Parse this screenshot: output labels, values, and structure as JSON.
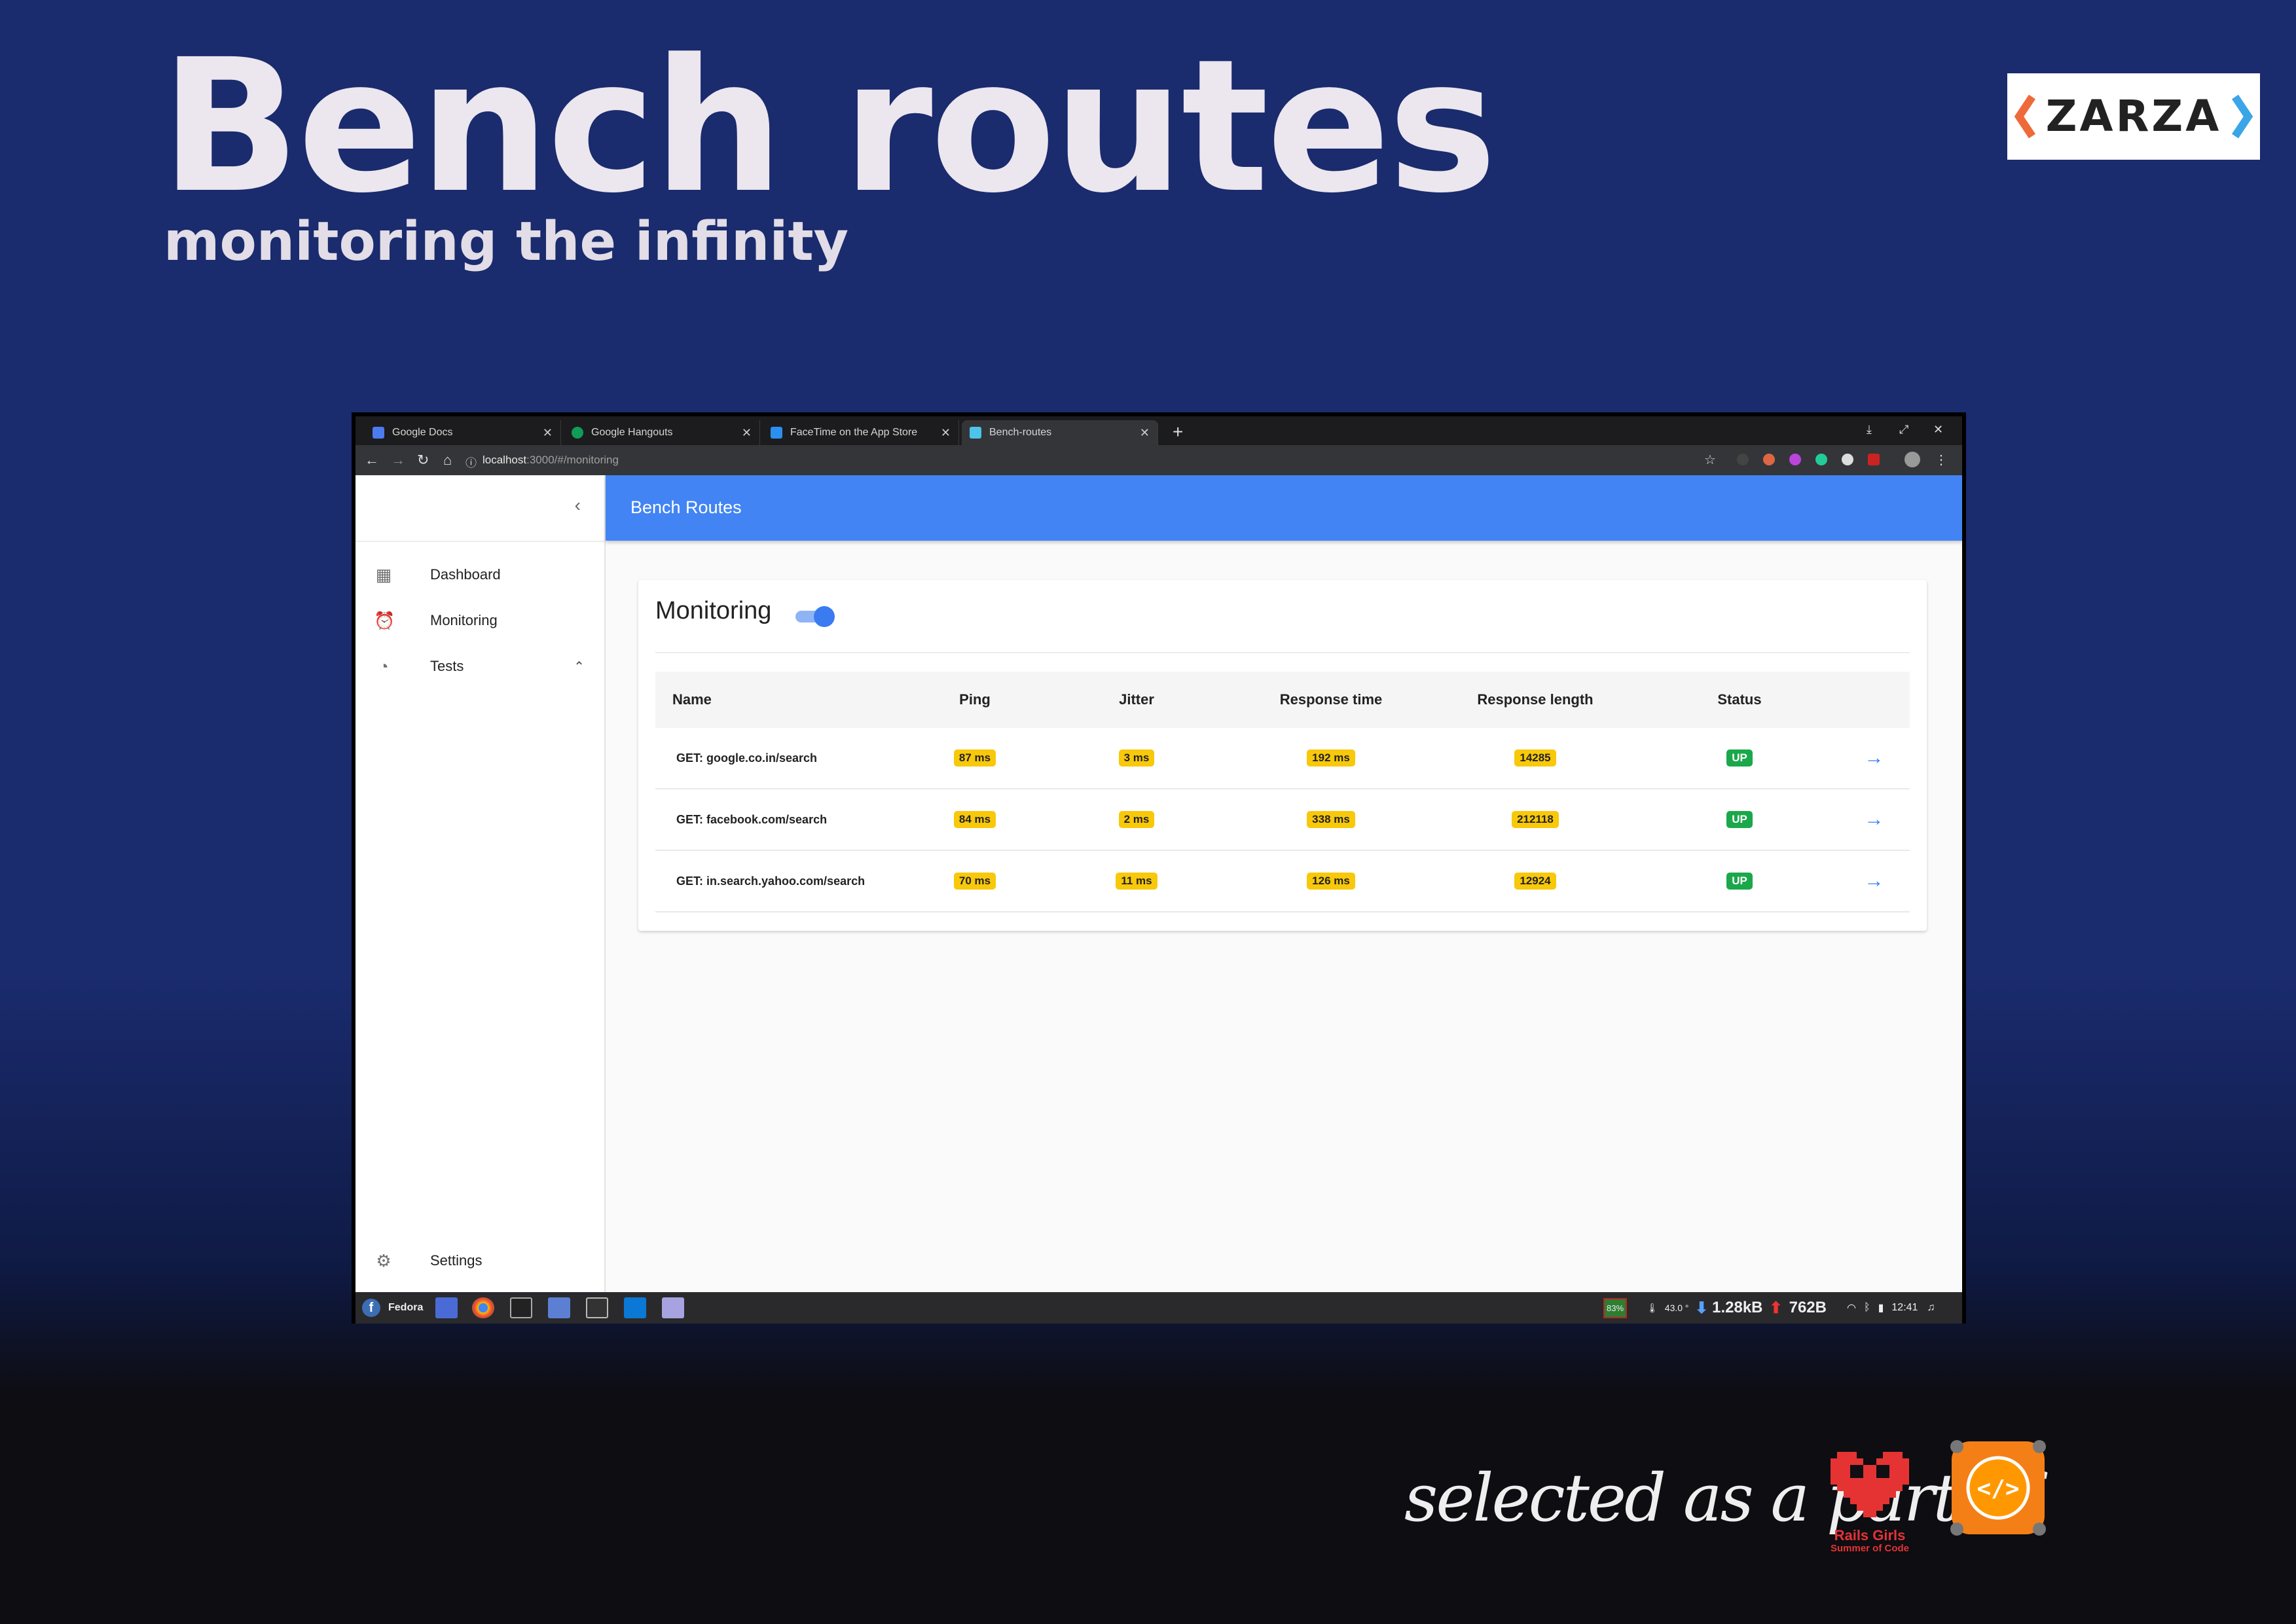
{
  "slide": {
    "title": "Bench routes",
    "subtitle": "monitoring the infinity",
    "logo_text": "ZARZA",
    "footer_text": "selected as a part of",
    "rgsoc_title": "Rails Girls",
    "rgsoc_sub": "Summer of Code",
    "code_badge": "</>"
  },
  "browser": {
    "tabs": [
      {
        "label": "Google Docs",
        "favicon_color": "#4b7bec"
      },
      {
        "label": "Google Hangouts",
        "favicon_color": "#0f9d58"
      },
      {
        "label": "FaceTime on the App Store",
        "favicon_color": "#2b8ff0"
      },
      {
        "label": "Bench-routes",
        "favicon_color": "#4ec4e8"
      }
    ],
    "new_tab_symbol": "+",
    "window_controls": [
      "⤓",
      "⤢",
      "✕"
    ],
    "url_host": "localhost",
    "url_path": ":3000/#/monitoring"
  },
  "app": {
    "appbar_title": "Bench Routes",
    "sidebar": {
      "items": [
        {
          "label": "Dashboard",
          "icon": "dashboard-icon"
        },
        {
          "label": "Monitoring",
          "icon": "alarm-icon"
        },
        {
          "label": "Tests",
          "icon": "wifi-icon"
        }
      ],
      "settings_label": "Settings"
    },
    "card_title": "Monitoring",
    "monitoring_enabled": true,
    "table": {
      "headers": [
        "Name",
        "Ping",
        "Jitter",
        "Response time",
        "Response length",
        "Status"
      ],
      "rows": [
        {
          "name": "GET: google.co.in/search",
          "ping": "87 ms",
          "jitter": "3 ms",
          "response_time": "192 ms",
          "response_length": "14285",
          "status": "UP"
        },
        {
          "name": "GET: facebook.com/search",
          "ping": "84 ms",
          "jitter": "2 ms",
          "response_time": "338 ms",
          "response_length": "212118",
          "status": "UP"
        },
        {
          "name": "GET: in.search.yahoo.com/search",
          "ping": "70 ms",
          "jitter": "11 ms",
          "response_time": "126 ms",
          "response_length": "12924",
          "status": "UP"
        }
      ]
    }
  },
  "taskbar": {
    "start_label": "Fedora",
    "cpu": "83%",
    "temp": "43.0 °",
    "download": "1.28kB",
    "upload": "762B",
    "clock": "12:41"
  },
  "colors": {
    "accent": "#4284f4",
    "chip_yellow": "#f8c80a",
    "status_up": "#1aa84a"
  }
}
